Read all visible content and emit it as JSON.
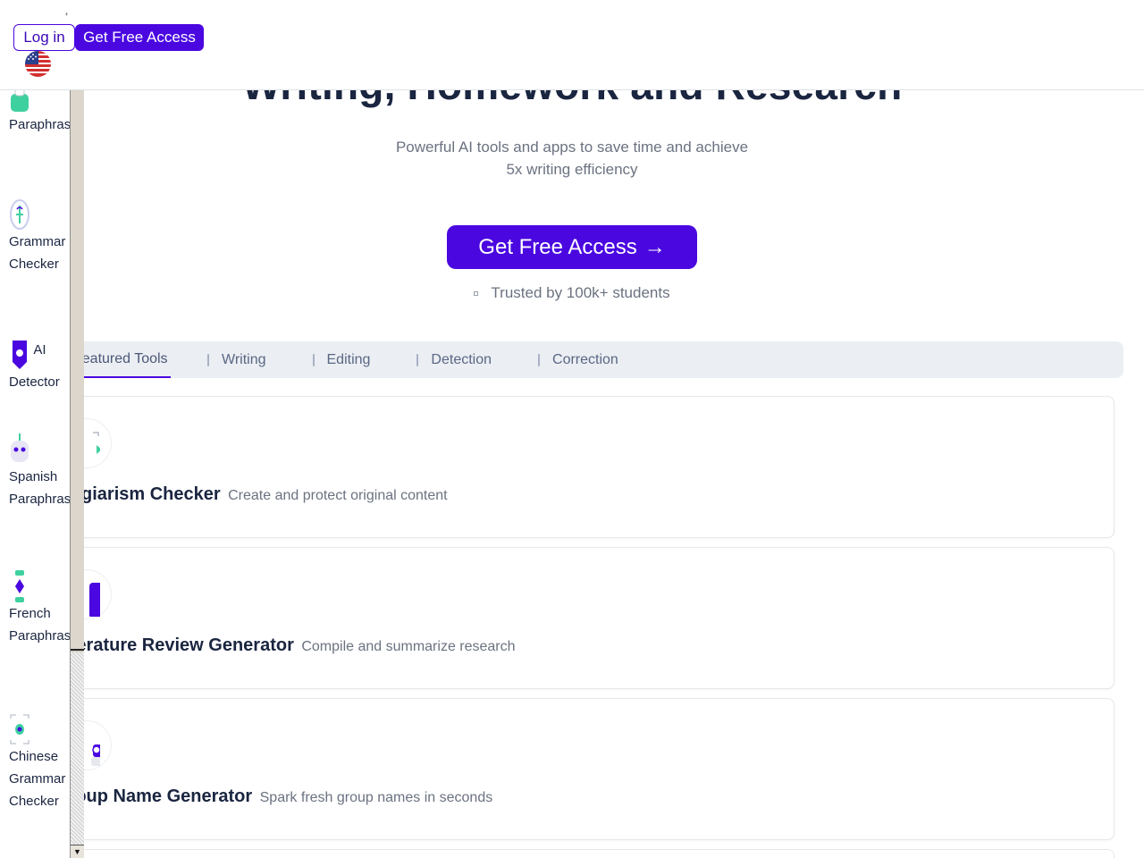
{
  "header": {
    "login_label": "Log in",
    "get_free_label": "Get Free Access",
    "flag_icon": "us-flag-icon"
  },
  "hero": {
    "title": "Writing, Homework and Research",
    "subtitle_line1": "Powerful AI tools and apps to save time and achieve",
    "subtitle_line2": "5x writing efficiency",
    "cta_label": "Get Free Access",
    "cta_arrow": "→",
    "trusted": "Trusted by 100k+ students"
  },
  "tabs": [
    {
      "label": "Featured Tools",
      "active": true
    },
    {
      "label": "Writing",
      "active": false
    },
    {
      "label": "Editing",
      "active": false
    },
    {
      "label": "Detection",
      "active": false
    },
    {
      "label": "Correction",
      "active": false
    }
  ],
  "tools": [
    {
      "title": "Plagiarism Checker",
      "description": "Create and protect original content",
      "icon": "plagiarism-icon"
    },
    {
      "title": "Literature Review Generator",
      "description": "Compile and summarize research",
      "icon": "literature-icon"
    },
    {
      "title": "Group Name Generator",
      "description": "Spark fresh group names in seconds",
      "icon": "group-name-icon"
    }
  ],
  "sidebar": {
    "items": [
      {
        "label": "Paraphraser",
        "icon": "paraphraser-icon"
      },
      {
        "label": "Grammar Checker",
        "icon": "grammar-icon"
      },
      {
        "label": "AI Detector",
        "icon": "ai-detector-icon"
      },
      {
        "label": "Spanish Paraphraser",
        "icon": "spanish-paraphraser-icon"
      },
      {
        "label": "French Paraphraser",
        "icon": "french-paraphraser-icon"
      },
      {
        "label": "Chinese Grammar Checker",
        "icon": "chinese-grammar-icon"
      }
    ]
  },
  "colors": {
    "brand": "#4a07e0",
    "text_dark": "#1a2540",
    "text_muted": "#6b7280",
    "tab_bg": "#ebeef2",
    "accent_green": "#3fd0a0"
  }
}
